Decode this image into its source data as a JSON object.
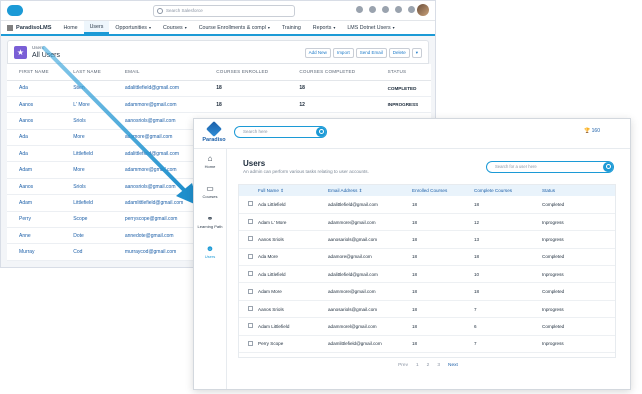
{
  "salesforce": {
    "app_name": "ParadisoLMS",
    "search_placeholder": "Search Salesforce",
    "nav": [
      {
        "label": "Home",
        "dropdown": false,
        "active": false
      },
      {
        "label": "Users",
        "dropdown": false,
        "active": true
      },
      {
        "label": "Opportunities",
        "dropdown": true,
        "active": false
      },
      {
        "label": "Courses",
        "dropdown": true,
        "active": false
      },
      {
        "label": "Course Enrollments & compl",
        "dropdown": true,
        "active": false
      },
      {
        "label": "Training",
        "dropdown": false,
        "active": false
      },
      {
        "label": "Reports",
        "dropdown": true,
        "active": false
      },
      {
        "label": "LMS Dotnet Users",
        "dropdown": true,
        "active": false
      }
    ],
    "list_kicker": "Users",
    "list_title": "All Users",
    "actions": [
      "Add New",
      "Import",
      "Send Email",
      "Delete"
    ],
    "columns": [
      "FIRST NAME",
      "LAST NAME",
      "EMAIL",
      "COURSES ENROLLED",
      "COURSES COMPLETED",
      "STATUS"
    ],
    "rows": [
      {
        "first": "Ada",
        "last": "Stien",
        "email": "adalittlefield@gmail.com",
        "enrolled": "18",
        "completed": "18",
        "status": "COMPLETED"
      },
      {
        "first": "Aanos",
        "last": "L' More",
        "email": "adammore@gmail.com",
        "enrolled": "18",
        "completed": "12",
        "status": "INPROGRESS"
      },
      {
        "first": "Aanos",
        "last": "Sriols",
        "email": "aanosriols@gmail.com",
        "enrolled": "18",
        "completed": "18",
        "status": "COMPLETED"
      },
      {
        "first": "Ada",
        "last": "More",
        "email": "adamore@gmail.com",
        "enrolled": "",
        "completed": "",
        "status": ""
      },
      {
        "first": "Ada",
        "last": "Littlefield",
        "email": "adalittlefield@gmail.com",
        "enrolled": "",
        "completed": "",
        "status": ""
      },
      {
        "first": "Adam",
        "last": "More",
        "email": "adammore@gmail.com",
        "enrolled": "",
        "completed": "",
        "status": ""
      },
      {
        "first": "Aanos",
        "last": "Sriols",
        "email": "aanosriols@gmail.com",
        "enrolled": "",
        "completed": "",
        "status": ""
      },
      {
        "first": "Adam",
        "last": "Littlefield",
        "email": "adamlittlefield@gmail.com",
        "enrolled": "",
        "completed": "",
        "status": ""
      },
      {
        "first": "Perry",
        "last": "Scope",
        "email": "perryscope@gmail.com",
        "enrolled": "",
        "completed": "",
        "status": ""
      },
      {
        "first": "Anne",
        "last": "Dote",
        "email": "annedote@gmail.com",
        "enrolled": "",
        "completed": "",
        "status": ""
      },
      {
        "first": "Murray",
        "last": "Cod",
        "email": "murraycod@gmail.com",
        "enrolled": "",
        "completed": "",
        "status": ""
      }
    ]
  },
  "paradiso": {
    "logo_text": "Paradiso",
    "search_placeholder": "Search here",
    "points": "160",
    "sidebar": [
      {
        "label": "Home",
        "icon": "home-icon",
        "glyph": "⌂",
        "active": false
      },
      {
        "label": "Courses",
        "icon": "laptop-icon",
        "glyph": "▭",
        "active": false
      },
      {
        "label": "Learning Path",
        "icon": "path-icon",
        "glyph": "⚭",
        "active": false
      },
      {
        "label": "Users",
        "icon": "users-icon",
        "glyph": "☻",
        "active": true
      }
    ],
    "title": "Users",
    "subtitle": "An admin can perform various tasks relating to user accounts.",
    "users_search_placeholder": "Search for a user here",
    "columns": [
      "Full Name ⇕",
      "Email Address ⇕",
      "Enrolled Courses",
      "Complete Courses",
      "Status"
    ],
    "rows": [
      {
        "name": "Ada Littlefield",
        "email": "adalittlefield@gmail.com",
        "enrolled": "18",
        "complete": "18",
        "status": "Completed"
      },
      {
        "name": "Adam L' More",
        "email": "adammore@gmail.com",
        "enrolled": "18",
        "complete": "12",
        "status": "Inprogress"
      },
      {
        "name": "Aanos Sriols",
        "email": "aanosariols@gmail.com",
        "enrolled": "18",
        "complete": "13",
        "status": "Inprogress"
      },
      {
        "name": "Ada More",
        "email": "adamore@gmail.com",
        "enrolled": "18",
        "complete": "18",
        "status": "Completed"
      },
      {
        "name": "Ada Littlefield",
        "email": "adalittlefield@gmail.com",
        "enrolled": "18",
        "complete": "10",
        "status": "Inprogress"
      },
      {
        "name": "Adam More",
        "email": "adammore@gmail.com",
        "enrolled": "18",
        "complete": "18",
        "status": "Completed"
      },
      {
        "name": "Aanos Sriols",
        "email": "aanosariols@gmail.com",
        "enrolled": "18",
        "complete": "7",
        "status": "Inprogress"
      },
      {
        "name": "Adam Littlefield",
        "email": "adammorel@gmail.com",
        "enrolled": "18",
        "complete": "6",
        "status": "Completed"
      },
      {
        "name": "Perry Scope",
        "email": "adamlittlefield@gmail.com",
        "enrolled": "18",
        "complete": "7",
        "status": "Inprogress"
      }
    ],
    "pager": {
      "prev": "Prev",
      "pages": [
        "1",
        "2",
        "3"
      ],
      "next": "Next"
    }
  },
  "colors": {
    "accent": "#1c9ad6",
    "brand": "#1c5fa8",
    "arrow": "#2a9bd0"
  }
}
